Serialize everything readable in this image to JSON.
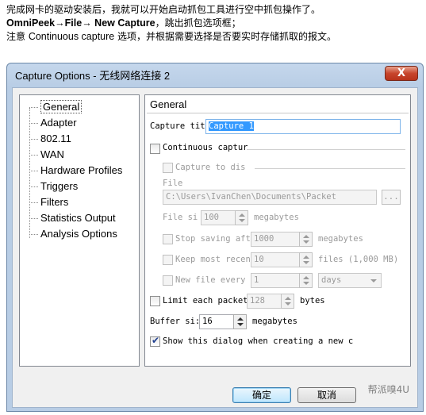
{
  "intro": {
    "line1": "完成网卡的驱动安装后，我就可以开始启动抓包工具进行空中抓包操作了。",
    "line2_app": "OmniPeek",
    "line2_arrow1": "→",
    "line2_file": "File",
    "line2_arrow2": "→",
    "line2_cmd": " New Capture",
    "line2_rest": "，跳出抓包选项框；",
    "line3_pre": "注意 ",
    "line3_kw": "Continuous capture",
    "line3_post": " 选项，并根据需要选择是否要实时存储抓取的报文。"
  },
  "window": {
    "title": "Capture Options - 无线网络连接 2",
    "close_label": "X"
  },
  "sidebar": {
    "items": [
      {
        "label": "General",
        "selected": true
      },
      {
        "label": "Adapter"
      },
      {
        "label": "802.11"
      },
      {
        "label": "WAN"
      },
      {
        "label": "Hardware Profiles"
      },
      {
        "label": "Triggers"
      },
      {
        "label": "Filters"
      },
      {
        "label": "Statistics Output"
      },
      {
        "label": "Analysis Options"
      }
    ]
  },
  "general": {
    "header": "General",
    "capture_title_label": "Capture tit",
    "capture_title_value": "Capture 1",
    "continuous_label": "Continuous captur",
    "continuous_checked": false,
    "capture_to_disk_label": "Capture to dis",
    "file_label": "File",
    "file_path": "C:\\Users\\IvanChen\\Documents\\Packet",
    "browse_label": "...",
    "file_size_label": "File si",
    "file_size_value": "100",
    "file_size_unit": "megabytes",
    "stop_label": "Stop saving aft",
    "stop_value": "1000",
    "stop_unit": "megabytes",
    "keep_label": "Keep most recen",
    "keep_value": "10",
    "keep_unit": "files (1,000 MB)",
    "new_file_label": "New file every",
    "new_file_value": "1",
    "new_file_unit": "days",
    "limit_label": "Limit each packet",
    "limit_value": "128",
    "limit_unit": "bytes",
    "buffer_label": "Buffer si:",
    "buffer_value": "16",
    "buffer_unit": "megabytes",
    "show_dialog_label": "Show this dialog when creating a new c",
    "show_dialog_checked": true
  },
  "buttons": {
    "ok": "确定",
    "cancel": "取消"
  },
  "watermark": "帮派嗅4U"
}
